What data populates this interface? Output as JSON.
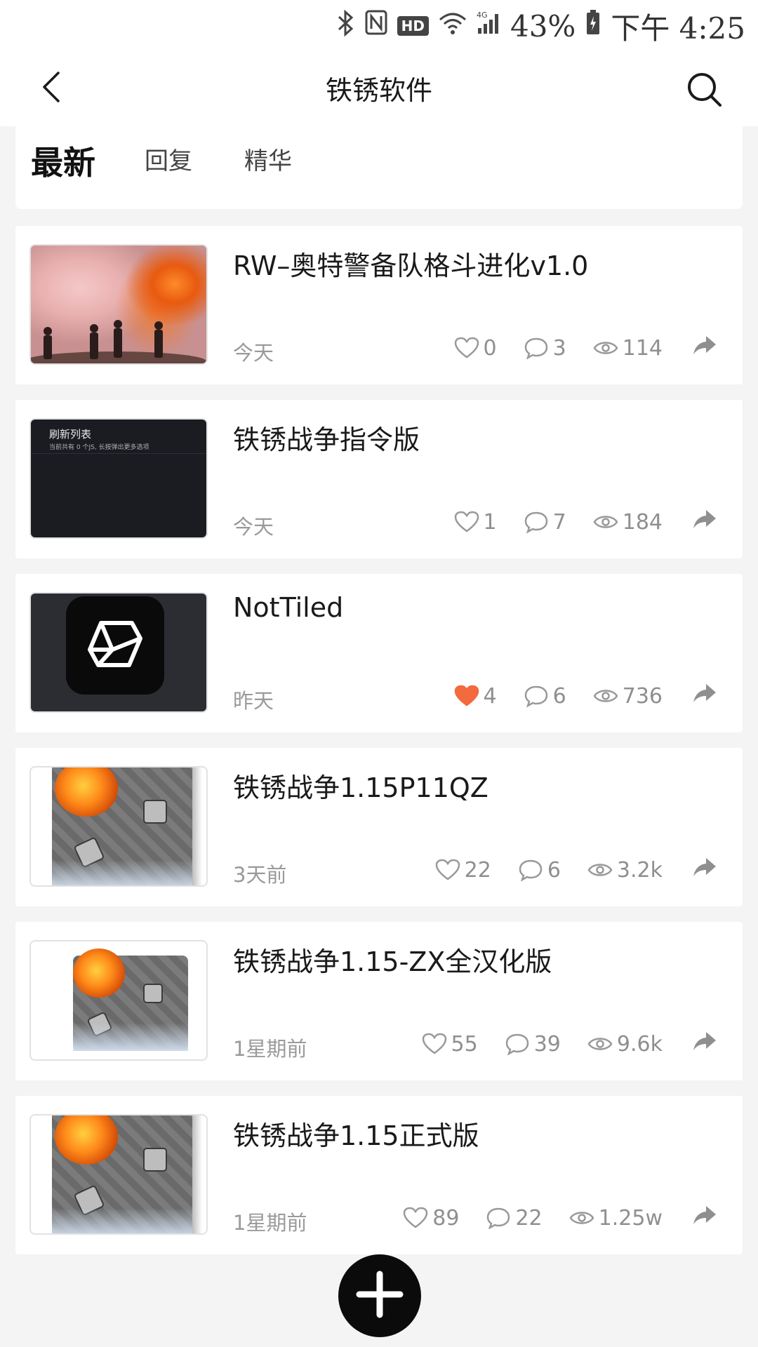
{
  "status_bar": {
    "hd": "HD",
    "battery": "43%",
    "time": "下午 4:25"
  },
  "header": {
    "title": "铁锈软件"
  },
  "tabs": [
    {
      "label": "最新"
    },
    {
      "label": "回复"
    },
    {
      "label": "精华"
    }
  ],
  "posts": [
    {
      "title": "RW–奥特警备队格斗进化v1.0",
      "time": "今天",
      "likes": "0",
      "comments": "3",
      "views": "114",
      "liked": false,
      "thumb": "explosion-photo"
    },
    {
      "title": "铁锈战争指令版",
      "time": "今天",
      "likes": "1",
      "comments": "7",
      "views": "184",
      "liked": false,
      "thumb": "dark-screenshot",
      "thumb_title": "刷新列表",
      "thumb_sub": "当前共有 0 个JS, 长按弹出更多选项"
    },
    {
      "title": "NotTiled",
      "time": "昨天",
      "likes": "4",
      "comments": "6",
      "views": "736",
      "liked": true,
      "thumb": "app-icon"
    },
    {
      "title": "铁锈战争1.15P11QZ",
      "time": "3天前",
      "likes": "22",
      "comments": "6",
      "views": "3.2k",
      "liked": false,
      "thumb": "game-screenshot"
    },
    {
      "title": "铁锈战争1.15-ZX全汉化版",
      "time": "1星期前",
      "likes": "55",
      "comments": "39",
      "views": "9.6k",
      "liked": false,
      "thumb": "game-screenshot"
    },
    {
      "title": "铁锈战争1.15正式版",
      "time": "1星期前",
      "likes": "89",
      "comments": "22",
      "views": "1.25w",
      "liked": false,
      "thumb": "game-screenshot"
    }
  ],
  "colors": {
    "accent_like": "#f26a3d",
    "muted_text": "#8f8f8f",
    "background": "#f4f4f4"
  },
  "icons": [
    "bluetooth-icon",
    "nfc-icon",
    "wifi-icon",
    "signal-4g-icon",
    "battery-icon",
    "back-arrow-icon",
    "search-icon",
    "heart-icon",
    "comment-icon",
    "eye-icon",
    "share-icon",
    "plus-icon"
  ]
}
